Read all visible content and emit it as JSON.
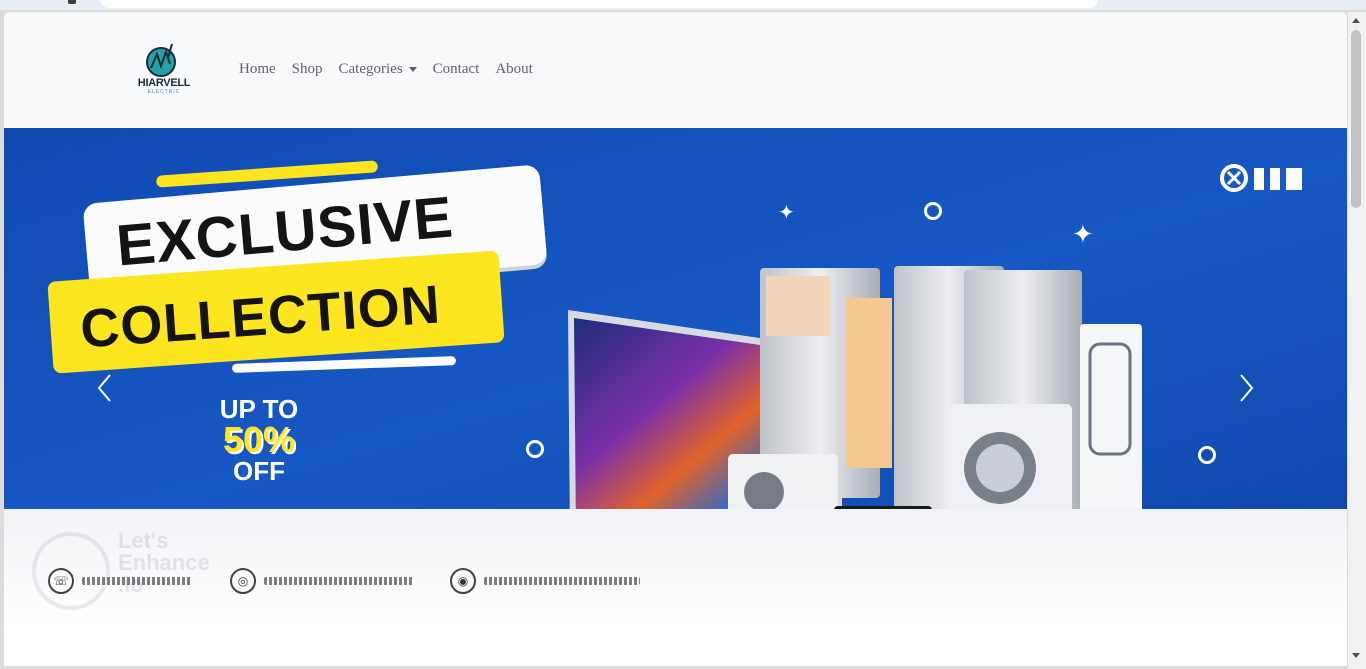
{
  "brand": {
    "name": "HIARVELL",
    "sub": "ELECTRIC"
  },
  "nav": {
    "items": [
      {
        "label": "Home"
      },
      {
        "label": "Shop"
      },
      {
        "label": "Categories"
      },
      {
        "label": "Contact"
      },
      {
        "label": "About"
      }
    ]
  },
  "hero": {
    "headline_1": "EXCLUSIVE",
    "headline_2": "COLLECTION",
    "discount_1": "UP TO",
    "discount_2": "50%",
    "discount_3": "OFF",
    "watermark_1": "Let's",
    "watermark_2": "Enhance",
    "watermark_3": ".io"
  },
  "carousel": {
    "prev_icon": "chevron-left-icon",
    "next_icon": "chevron-right-icon"
  },
  "colors": {
    "hero_blue": "#1553b8",
    "accent_yellow": "#fde51f",
    "navbar_bg": "#f8f9fa"
  }
}
